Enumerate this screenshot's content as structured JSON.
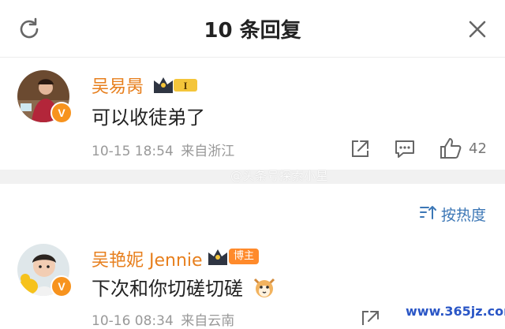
{
  "header": {
    "title": "10 条回复",
    "refresh_icon": "refresh-icon",
    "close_icon": "close-icon"
  },
  "comments": [
    {
      "username": "吴易昺",
      "level": "I",
      "text": "可以收徒弟了",
      "date": "10-15 18:54",
      "source": "来自浙江",
      "likes": "42"
    },
    {
      "username": "吴艳妮 Jennie",
      "tag": "博主",
      "text": "下次和你切磋切磋",
      "date": "10-16 08:34",
      "source": "来自云南"
    }
  ],
  "watermark": "@头条号探索小星",
  "sort": {
    "label": "按热度",
    "icon": "sort-icon"
  },
  "site_stamp": "www.365jz.com",
  "colors": {
    "username": "#e77f1d",
    "link": "#3c77b6",
    "verified": "#f7931e"
  }
}
